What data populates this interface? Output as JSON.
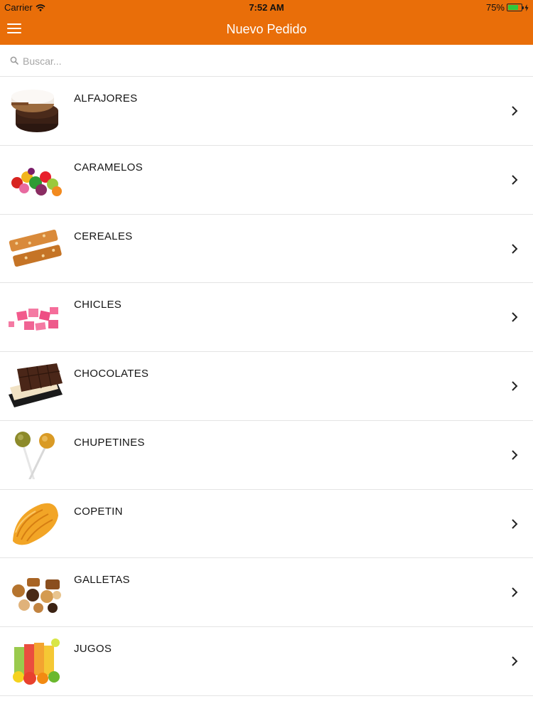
{
  "status_bar": {
    "carrier": "Carrier",
    "time": "7:52 AM",
    "battery": "75%",
    "battery_level": 0.75
  },
  "header": {
    "title": "Nuevo Pedido",
    "color": "#e96e09"
  },
  "search": {
    "placeholder": "Buscar...",
    "value": ""
  },
  "categories": [
    {
      "label": "ALFAJORES",
      "icon": "alfajor-image"
    },
    {
      "label": "CARAMELOS",
      "icon": "candy-image"
    },
    {
      "label": "CEREALES",
      "icon": "cereal-bar-image"
    },
    {
      "label": "CHICLES",
      "icon": "chewing-gum-image"
    },
    {
      "label": "CHOCOLATES",
      "icon": "chocolate-bar-image"
    },
    {
      "label": "CHUPETINES",
      "icon": "lollipop-image"
    },
    {
      "label": "COPETIN",
      "icon": "potato-chips-image"
    },
    {
      "label": "GALLETAS",
      "icon": "cookies-image"
    },
    {
      "label": "JUGOS",
      "icon": "juice-image"
    }
  ]
}
